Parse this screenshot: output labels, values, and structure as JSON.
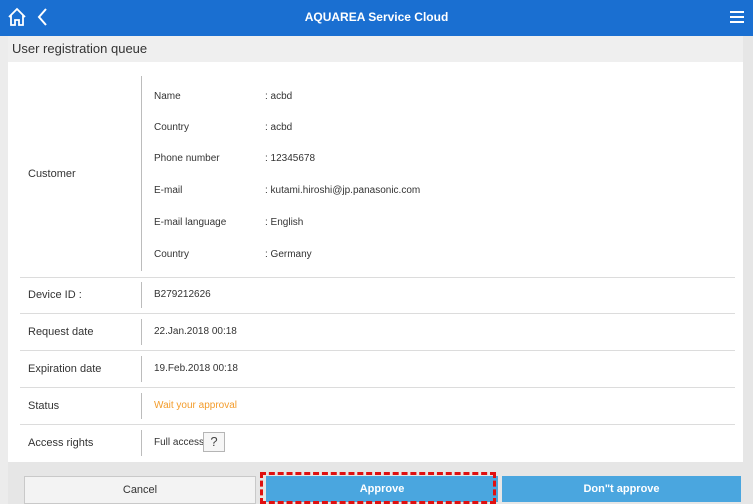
{
  "app": {
    "title": "AQUAREA Service Cloud"
  },
  "header": {
    "title": "User registration queue"
  },
  "customer": {
    "label": "Customer",
    "fields": [
      {
        "label": "Name",
        "value": ": acbd"
      },
      {
        "label": "Country",
        "value": ": acbd"
      },
      {
        "label": "Phone number",
        "value": ": 12345678"
      },
      {
        "label": "E-mail",
        "value": ": kutami.hiroshi@jp.panasonic.com"
      },
      {
        "label": "E-mail language",
        "value": ": English"
      },
      {
        "label": "Country",
        "value": ": Germany"
      }
    ]
  },
  "rows": {
    "device_id": {
      "label": "Device ID :",
      "value": "B279212626"
    },
    "request_date": {
      "label": "Request date",
      "value": "22.Jan.2018 00:18"
    },
    "expiration_date": {
      "label": "Expiration date",
      "value": "19.Feb.2018 00:18"
    },
    "status": {
      "label": "Status",
      "value": "Wait your approval"
    },
    "access_rights": {
      "label": "Access rights",
      "value": "Full access",
      "help": "?"
    }
  },
  "buttons": {
    "cancel": "Cancel",
    "approve": "Approve",
    "deny": "Don\"t approve"
  },
  "colors": {
    "topbar": "#1a6fd1",
    "button": "#4aa6df",
    "status": "#f39c2b",
    "highlight": "#e01010"
  },
  "icons": {
    "home": "home-icon",
    "back": "back-arrow-icon",
    "menu": "hamburger-menu-icon",
    "help": "help-icon"
  }
}
